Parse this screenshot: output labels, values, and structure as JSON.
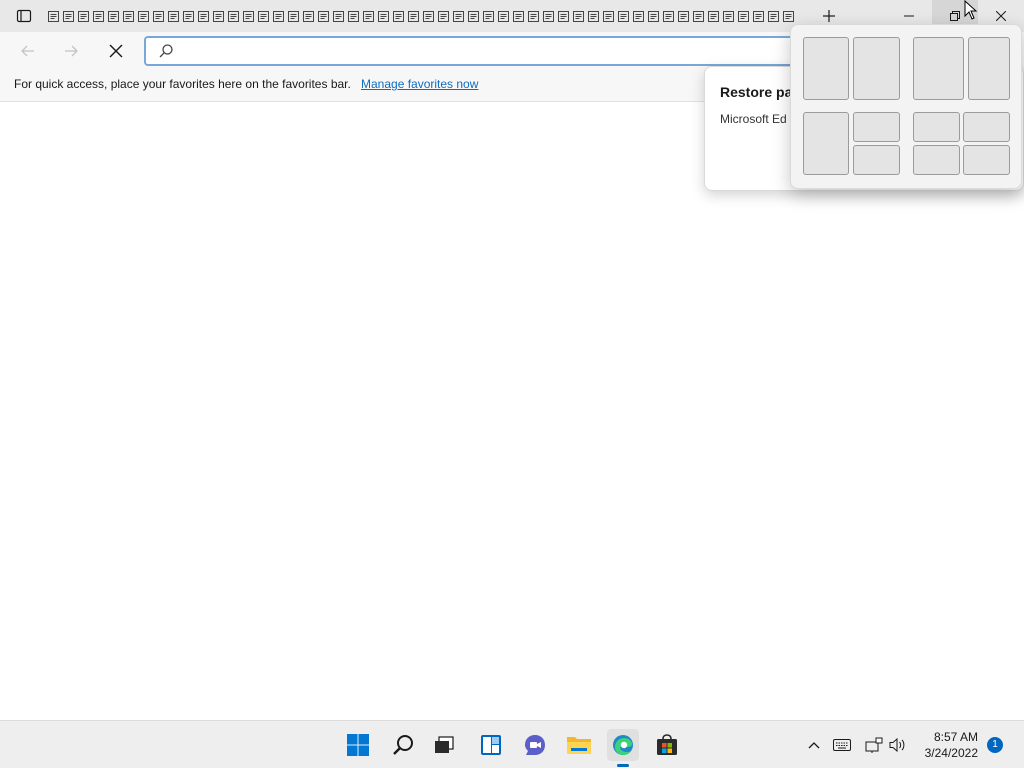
{
  "browser": {
    "tab_count": 50,
    "favorites_bar": {
      "message": "For quick access, place your favorites here on the favorites bar.",
      "link": "Manage favorites now"
    },
    "address_bar": {
      "value": "",
      "placeholder": ""
    }
  },
  "restore_popup": {
    "title": "Restore pa",
    "body": "Microsoft Ed"
  },
  "snap_layouts": {
    "layouts": [
      "two-columns-equal",
      "two-columns-wide-left",
      "three-split",
      "four-grid"
    ]
  },
  "taskbar": {
    "apps": [
      "start",
      "search",
      "task-view",
      "widgets",
      "chat",
      "file-explorer",
      "edge",
      "store"
    ],
    "active_app": "edge",
    "clock": {
      "time": "8:57 AM",
      "date": "3/24/2022"
    },
    "notification_count": "1"
  },
  "colors": {
    "accent": "#0067c0",
    "link": "#0f6cbd"
  }
}
